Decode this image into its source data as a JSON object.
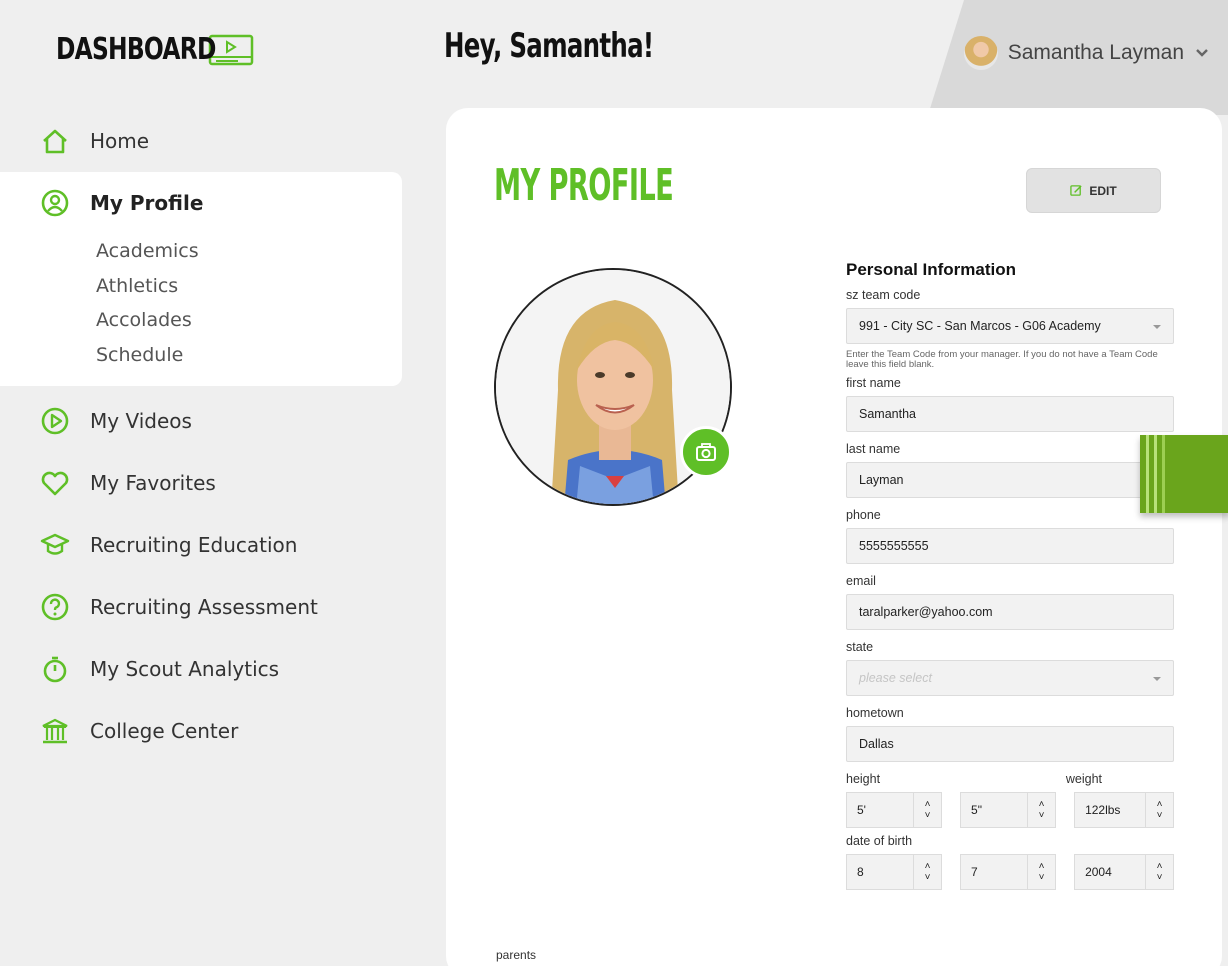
{
  "brand": {
    "title": "DASHBOARD",
    "icon": "video-player-icon"
  },
  "greeting": "Hey, Samantha!",
  "user": {
    "name": "Samantha Layman",
    "menu_icon": "chevron-down-icon"
  },
  "colors": {
    "accent": "#5fbf27",
    "tab": "#6aa51c"
  },
  "nav": {
    "home": "Home",
    "profile": "My Profile",
    "profile_sub": [
      "Academics",
      "Athletics",
      "Accolades",
      "Schedule"
    ],
    "videos": "My Videos",
    "favorites": "My Favorites",
    "education": "Recruiting Education",
    "assessment": "Recruiting Assessment",
    "analytics": "My Scout Analytics",
    "college": "College Center"
  },
  "main": {
    "title": "MY PROFILE",
    "edit_label": "EDIT",
    "parents_label": "parents"
  },
  "form": {
    "heading": "Personal Information",
    "team_code": {
      "label": "sz team code",
      "value": "991 - City SC - San Marcos - G06 Academy",
      "help": "Enter the Team Code from your manager. If you do not have a Team Code leave this field blank."
    },
    "first_name": {
      "label": "first name",
      "value": "Samantha"
    },
    "last_name": {
      "label": "last name",
      "value": "Layman"
    },
    "phone": {
      "label": "phone",
      "value": "5555555555"
    },
    "email": {
      "label": "email",
      "value": "taralparker@yahoo.com"
    },
    "state": {
      "label": "state",
      "placeholder": "please select"
    },
    "hometown": {
      "label": "hometown",
      "value": "Dallas"
    },
    "height": {
      "label": "height",
      "feet": "5'",
      "inches": "5\""
    },
    "weight": {
      "label": "weight",
      "value": "122lbs"
    },
    "dob": {
      "label": "date of birth",
      "month": "8",
      "day": "7",
      "year": "2004"
    }
  }
}
